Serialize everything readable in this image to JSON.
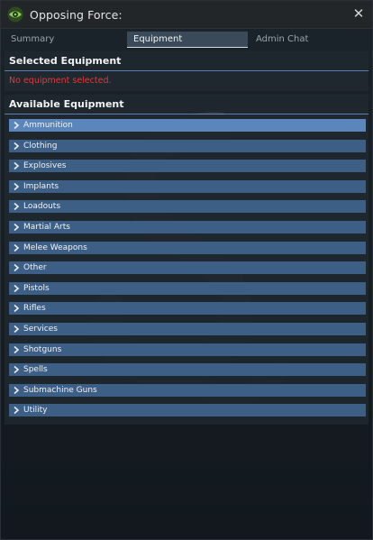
{
  "window": {
    "title": "Opposing Force:",
    "close_glyph": "✕",
    "title_icon": "eye-icon"
  },
  "tabs": [
    {
      "label": "Summary",
      "active": false
    },
    {
      "label": "Equipment",
      "active": true
    },
    {
      "label": "Admin Chat",
      "active": false
    }
  ],
  "selected": {
    "header": "Selected Equipment",
    "empty_text": "No equipment selected."
  },
  "available": {
    "header": "Available Equipment",
    "categories": [
      {
        "label": "Ammunition",
        "highlighted": true
      },
      {
        "label": "Clothing"
      },
      {
        "label": "Explosives"
      },
      {
        "label": "Implants"
      },
      {
        "label": "Loadouts"
      },
      {
        "label": "Martial Arts"
      },
      {
        "label": "Melee Weapons"
      },
      {
        "label": "Other"
      },
      {
        "label": "Pistols"
      },
      {
        "label": "Rifles"
      },
      {
        "label": "Services"
      },
      {
        "label": "Shotguns"
      },
      {
        "label": "Spells"
      },
      {
        "label": "Submachine Guns"
      },
      {
        "label": "Utility"
      }
    ]
  },
  "colors": {
    "accent": "#5a7fae",
    "category_bg": "#3d5f85",
    "category_hover": "#5a86bb",
    "error_text": "#e03b3b",
    "eye_icon": "#8fd14f"
  }
}
